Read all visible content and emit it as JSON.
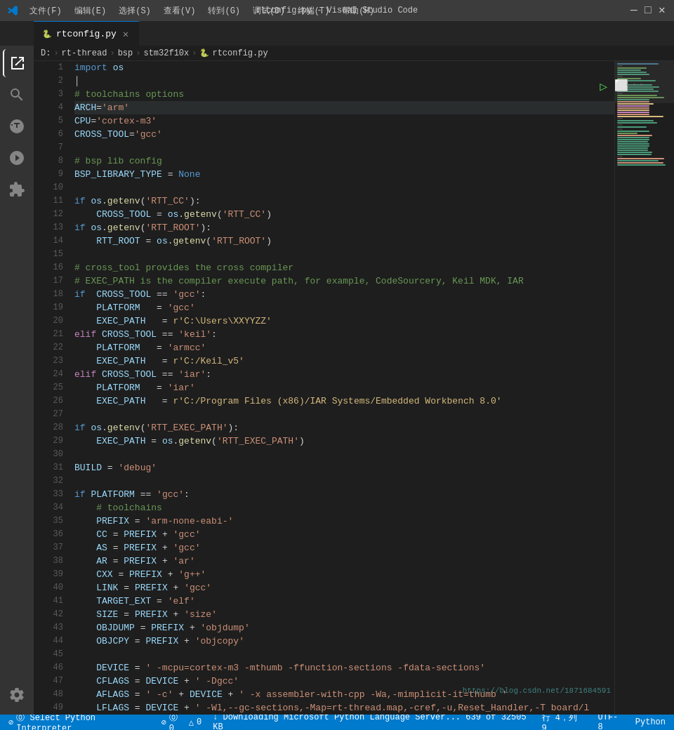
{
  "titleBar": {
    "title": "rtconfig.py - Visual Studio Code",
    "menuItems": [
      "文件(F)",
      "编辑(E)",
      "选择(S)",
      "查看(V)",
      "转到(G)",
      "调试(D)",
      "终端(T)",
      "帮助(H)"
    ],
    "controls": [
      "—",
      "□",
      "✕"
    ]
  },
  "tabs": [
    {
      "id": "rtconfig",
      "label": "rtconfig.py",
      "active": true,
      "icon": "🐍"
    }
  ],
  "breadcrumb": {
    "items": [
      "D:",
      "rt-thread",
      "bsp",
      "stm32f10x",
      "rtconfig.py"
    ]
  },
  "activityBar": {
    "icons": [
      "explorer",
      "search",
      "git",
      "debug",
      "extensions",
      "remote"
    ],
    "bottomIcons": [
      "settings"
    ]
  },
  "editor": {
    "lines": [
      {
        "num": 1,
        "code": "import os"
      },
      {
        "num": 2,
        "code": ""
      },
      {
        "num": 3,
        "code": "# toolchains options"
      },
      {
        "num": 4,
        "code": "ARCH='arm'"
      },
      {
        "num": 5,
        "code": "CPU='cortex-m3'"
      },
      {
        "num": 6,
        "code": "CROSS_TOOL='gcc'"
      },
      {
        "num": 7,
        "code": ""
      },
      {
        "num": 8,
        "code": "# bsp lib config"
      },
      {
        "num": 9,
        "code": "BSP_LIBRARY_TYPE = None"
      },
      {
        "num": 10,
        "code": ""
      },
      {
        "num": 11,
        "code": "if os.getenv('RTT_CC'):"
      },
      {
        "num": 12,
        "code": "    CROSS_TOOL = os.getenv('RTT_CC')"
      },
      {
        "num": 13,
        "code": "if os.getenv('RTT_ROOT'):"
      },
      {
        "num": 14,
        "code": "    RTT_ROOT = os.getenv('RTT_ROOT')"
      },
      {
        "num": 15,
        "code": ""
      },
      {
        "num": 16,
        "code": "# cross_tool provides the cross compiler"
      },
      {
        "num": 17,
        "code": "# EXEC_PATH is the compiler execute path, for example, CodeSourcery, Keil MDK, IAR"
      },
      {
        "num": 18,
        "code": "if  CROSS_TOOL == 'gcc':"
      },
      {
        "num": 19,
        "code": "    PLATFORM   = 'gcc'"
      },
      {
        "num": 20,
        "code": "    EXEC_PATH   = r'C:\\Users\\XXYYZZ'"
      },
      {
        "num": 21,
        "code": "elif CROSS_TOOL == 'keil':"
      },
      {
        "num": 22,
        "code": "    PLATFORM   = 'armcc'"
      },
      {
        "num": 23,
        "code": "    EXEC_PATH   = r'C:/Keil_v5'"
      },
      {
        "num": 24,
        "code": "elif CROSS_TOOL == 'iar':"
      },
      {
        "num": 25,
        "code": "    PLATFORM   = 'iar'"
      },
      {
        "num": 26,
        "code": "    EXEC_PATH   = r'C:/Program Files (x86)/IAR Systems/Embedded Workbench 8.0'"
      },
      {
        "num": 27,
        "code": ""
      },
      {
        "num": 28,
        "code": "if os.getenv('RTT_EXEC_PATH'):"
      },
      {
        "num": 29,
        "code": "    EXEC_PATH = os.getenv('RTT_EXEC_PATH')"
      },
      {
        "num": 30,
        "code": ""
      },
      {
        "num": 31,
        "code": "BUILD = 'debug'"
      },
      {
        "num": 32,
        "code": ""
      },
      {
        "num": 33,
        "code": "if PLATFORM == 'gcc':"
      },
      {
        "num": 34,
        "code": "    # toolchains"
      },
      {
        "num": 35,
        "code": "    PREFIX = 'arm-none-eabi-'"
      },
      {
        "num": 36,
        "code": "    CC = PREFIX + 'gcc'"
      },
      {
        "num": 37,
        "code": "    AS = PREFIX + 'gcc'"
      },
      {
        "num": 38,
        "code": "    AR = PREFIX + 'ar'"
      },
      {
        "num": 39,
        "code": "    CXX = PREFIX + 'g++'"
      },
      {
        "num": 40,
        "code": "    LINK = PREFIX + 'gcc'"
      },
      {
        "num": 41,
        "code": "    TARGET_EXT = 'elf'"
      },
      {
        "num": 42,
        "code": "    SIZE = PREFIX + 'size'"
      },
      {
        "num": 43,
        "code": "    OBJDUMP = PREFIX + 'objdump'"
      },
      {
        "num": 44,
        "code": "    OBJCPY = PREFIX + 'objcopy'"
      },
      {
        "num": 45,
        "code": ""
      },
      {
        "num": 46,
        "code": "    DEVICE = ' -mcpu=cortex-m3 -mthumb -ffunction-sections -fdata-sections'"
      },
      {
        "num": 47,
        "code": "    CFLAGS = DEVICE + ' -Dgcc'"
      },
      {
        "num": 48,
        "code": "    AFLAGS = ' -c' + DEVICE + ' -x assembler-with-cpp -Wa,-mimplicit-it=thumb '"
      },
      {
        "num": 49,
        "code": "    LFLAGS = DEVICE + ' -Wl,--gc-sections,-Map=rt-thread.map,-cref,-u,Reset_Handler,-T board/l"
      }
    ]
  },
  "statusBar": {
    "left": {
      "python_interpreter": "⓪ Select Python Interpreter",
      "errors": "⓪ 0",
      "warnings": "△ 0",
      "downloading": "↓ Downloading Microsoft Python Language Server... 639 of 32505 KB"
    },
    "right": {
      "line_col": "行 4，列 9",
      "encoding": "UTF-8",
      "language": "Python"
    }
  },
  "watermark": "https://blog.csdn.net/1871684591"
}
